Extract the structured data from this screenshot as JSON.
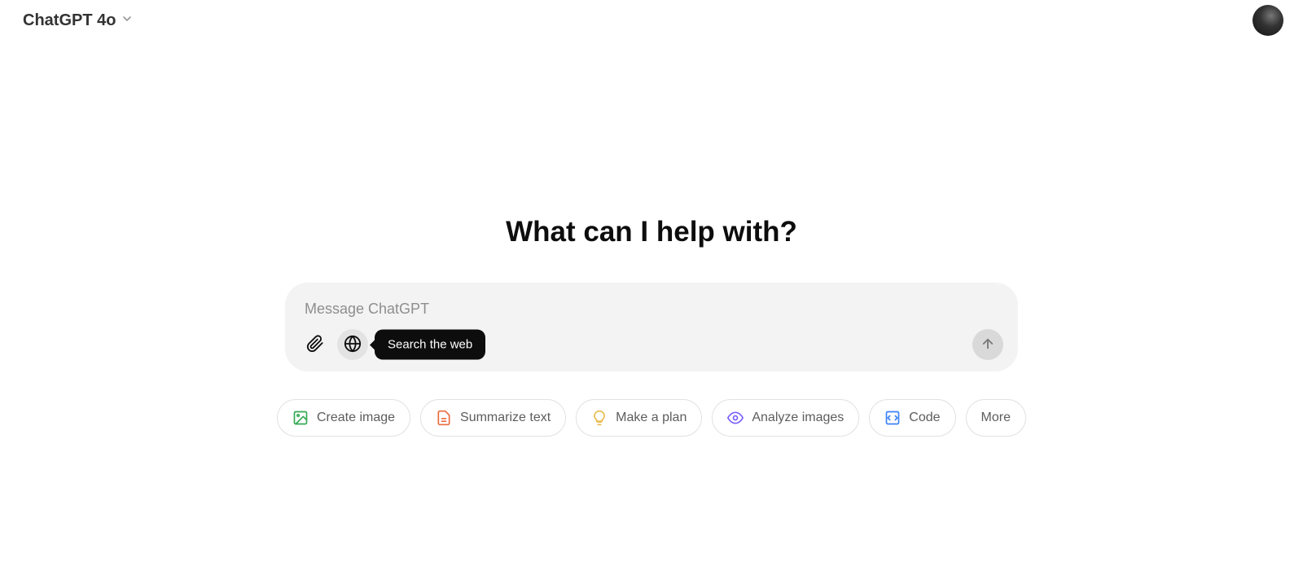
{
  "header": {
    "model_name": "ChatGPT 4o"
  },
  "main": {
    "heading": "What can I help with?",
    "input_placeholder": "Message ChatGPT",
    "tooltip_search_web": "Search the web"
  },
  "chips": [
    {
      "label": "Create image",
      "icon": "image-icon",
      "color": "#34a853"
    },
    {
      "label": "Summarize text",
      "icon": "document-icon",
      "color": "#ea6b3d"
    },
    {
      "label": "Make a plan",
      "icon": "lightbulb-icon",
      "color": "#f2c94c"
    },
    {
      "label": "Analyze images",
      "icon": "eye-icon",
      "color": "#7b61ff"
    },
    {
      "label": "Code",
      "icon": "code-icon",
      "color": "#3b82f6"
    },
    {
      "label": "More",
      "icon": null,
      "color": null
    }
  ]
}
